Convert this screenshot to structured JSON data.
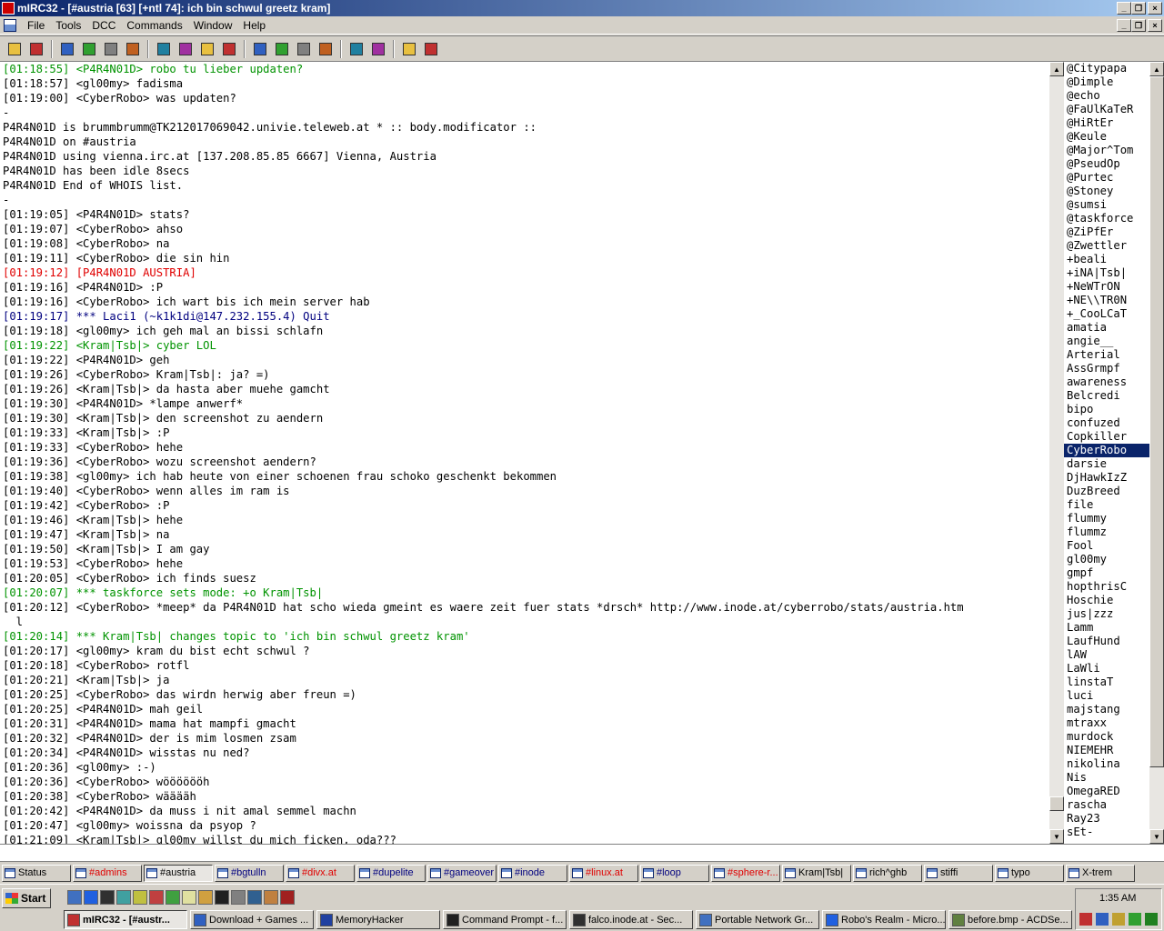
{
  "window": {
    "title": "mIRC32 - [#austria [63] [+ntl 74]: ich bin schwul greetz kram]"
  },
  "menu": {
    "items": [
      "File",
      "Tools",
      "DCC",
      "Commands",
      "Window",
      "Help"
    ]
  },
  "toolbar": {
    "icons": [
      "connect-icon",
      "options-icon",
      "address-book-icon",
      "remote-icon",
      "list-channels-icon",
      "chat-icon",
      "received-files-icon",
      "finger-icon",
      "timer-icon",
      "colors-icon",
      "log-icon",
      "notify-icon",
      "urls-icon",
      "cascade-icon",
      "tile-icon",
      "tile-vertical-icon",
      "help-icon",
      "about-icon"
    ]
  },
  "colors": {
    "green": "#009300",
    "red": "#e00000",
    "blue": "#00007f",
    "black": "#000000"
  },
  "chat": {
    "lines": [
      {
        "text": "[01:18:55] <P4R4N01D> robo tu lieber updaten?",
        "color": "#009300"
      },
      {
        "text": "[01:18:57] <gl00my> fadisma",
        "color": "#000000"
      },
      {
        "text": "[01:19:00] <CyberRobo> was updaten?",
        "color": "#000000"
      },
      {
        "text": "-",
        "color": "#000000"
      },
      {
        "text": "P4R4N01D is brummbrumm@TK212017069042.univie.teleweb.at * :: body.modificator ::",
        "color": "#000000"
      },
      {
        "text": "P4R4N01D on #austria",
        "color": "#000000"
      },
      {
        "text": "P4R4N01D using vienna.irc.at [137.208.85.85 6667] Vienna, Austria",
        "color": "#000000"
      },
      {
        "text": "P4R4N01D has been idle 8secs",
        "color": "#000000"
      },
      {
        "text": "P4R4N01D End of WHOIS list.",
        "color": "#000000"
      },
      {
        "text": "-",
        "color": "#000000"
      },
      {
        "text": "[01:19:05] <P4R4N01D> stats?",
        "color": "#000000"
      },
      {
        "text": "[01:19:07] <CyberRobo> ahso",
        "color": "#000000"
      },
      {
        "text": "[01:19:08] <CyberRobo> na",
        "color": "#000000"
      },
      {
        "text": "[01:19:11] <CyberRobo> die sin hin",
        "color": "#000000"
      },
      {
        "text": "[01:19:12] [P4R4N01D AUSTRIA]",
        "color": "#e00000"
      },
      {
        "text": "[01:19:16] <P4R4N01D> :P",
        "color": "#000000"
      },
      {
        "text": "[01:19:16] <CyberRobo> ich wart bis ich mein server hab",
        "color": "#000000"
      },
      {
        "text": "[01:19:17] *** Laci1 (~k1k1di@147.232.155.4) Quit",
        "color": "#00007f"
      },
      {
        "text": "[01:19:18] <gl00my> ich geh mal an bissi schlafn",
        "color": "#000000"
      },
      {
        "text": "[01:19:22] <Kram|Tsb|> cyber LOL",
        "color": "#009300"
      },
      {
        "text": "[01:19:22] <P4R4N01D> geh",
        "color": "#000000"
      },
      {
        "text": "[01:19:26] <CyberRobo> Kram|Tsb|: ja? =)",
        "color": "#000000"
      },
      {
        "text": "[01:19:26] <Kram|Tsb|> da hasta aber muehe gamcht",
        "color": "#000000"
      },
      {
        "text": "[01:19:30] <P4R4N01D> *lampe anwerf*",
        "color": "#000000"
      },
      {
        "text": "[01:19:30] <Kram|Tsb|> den screenshot zu aendern",
        "color": "#000000"
      },
      {
        "text": "[01:19:33] <Kram|Tsb|> :P",
        "color": "#000000"
      },
      {
        "text": "[01:19:33] <CyberRobo> hehe",
        "color": "#000000"
      },
      {
        "text": "[01:19:36] <CyberRobo> wozu screenshot aendern?",
        "color": "#000000"
      },
      {
        "text": "[01:19:38] <gl00my> ich hab heute von einer schoenen frau schoko geschenkt bekommen",
        "color": "#000000"
      },
      {
        "text": "[01:19:40] <CyberRobo> wenn alles im ram is",
        "color": "#000000"
      },
      {
        "text": "[01:19:42] <CyberRobo> :P",
        "color": "#000000"
      },
      {
        "text": "[01:19:46] <Kram|Tsb|> hehe",
        "color": "#000000"
      },
      {
        "text": "[01:19:47] <Kram|Tsb|> na",
        "color": "#000000"
      },
      {
        "text": "[01:19:50] <Kram|Tsb|> I am gay",
        "color": "#000000"
      },
      {
        "text": "[01:19:53] <CyberRobo> hehe",
        "color": "#000000"
      },
      {
        "text": "[01:20:05] <CyberRobo> ich finds suesz",
        "color": "#000000"
      },
      {
        "text": "[01:20:07] *** taskforce sets mode: +o Kram|Tsb|",
        "color": "#009300"
      },
      {
        "text": "[01:20:12] <CyberRobo> *meep* da P4R4N01D hat scho wieda gmeint es waere zeit fuer stats *drsch* http://www.inode.at/cyberrobo/stats/austria.htm",
        "color": "#000000"
      },
      {
        "text": "  l",
        "color": "#000000"
      },
      {
        "text": "[01:20:14] *** Kram|Tsb| changes topic to 'ich bin schwul greetz kram'",
        "color": "#009300"
      },
      {
        "text": "[01:20:17] <gl00my> kram du bist echt schwul ?",
        "color": "#000000"
      },
      {
        "text": "[01:20:18] <CyberRobo> rotfl",
        "color": "#000000"
      },
      {
        "text": "[01:20:21] <Kram|Tsb|> ja",
        "color": "#000000"
      },
      {
        "text": "[01:20:25] <CyberRobo> das wirdn herwig aber freun =)",
        "color": "#000000"
      },
      {
        "text": "[01:20:25] <P4R4N01D> mah geil",
        "color": "#000000"
      },
      {
        "text": "[01:20:31] <P4R4N01D> mama hat mampfi gmacht",
        "color": "#000000"
      },
      {
        "text": "[01:20:32] <P4R4N01D> der is mim losmen zsam",
        "color": "#000000"
      },
      {
        "text": "[01:20:34] <P4R4N01D> wisstas nu ned?",
        "color": "#000000"
      },
      {
        "text": "[01:20:36] <gl00my> :-)",
        "color": "#000000"
      },
      {
        "text": "[01:20:36] <CyberRobo> wööööööh",
        "color": "#000000"
      },
      {
        "text": "[01:20:38] <CyberRobo> wääääh",
        "color": "#000000"
      },
      {
        "text": "[01:20:42] <P4R4N01D> da muss i nit amal semmel machn",
        "color": "#000000"
      },
      {
        "text": "[01:20:47] <gl00my> woissna da psyop ?",
        "color": "#000000"
      },
      {
        "text": "[01:21:09] <Kram|Tsb|> gl00my willst du mich ficken, oda???",
        "color": "#000000"
      }
    ]
  },
  "nicklist": {
    "selected": "CyberRobo",
    "nicks": [
      "@Citypapa",
      "@Dimple",
      "@echo",
      "@FaUlKaTeR",
      "@HiRtEr",
      "@Keule",
      "@Major^Tom",
      "@PseudOp",
      "@Purtec",
      "@Stoney",
      "@sumsi",
      "@taskforce",
      "@ZiPfEr",
      "@Zwettler",
      "+beali",
      "+iNA|Tsb|",
      "+NeWTrON",
      "+NE\\\\TR0N",
      "+_CooLCaT",
      "amatia",
      "angie__",
      "Arterial",
      "AssGrmpf",
      "awareness",
      "Belcredi",
      "bipo",
      "confuzed",
      "Copkiller",
      "CyberRobo",
      "darsie",
      "DjHawkIzZ",
      "DuzBreed",
      "file",
      "flummy",
      "flummz",
      "Fool",
      "gl00my",
      "gmpf",
      "hopthrisC",
      "Hoschie",
      "jus|zzz",
      "Lamm",
      "LaufHund",
      "lAW",
      "LaWli",
      "linstaT",
      "luci",
      "majstang",
      "mtraxx",
      "murdock",
      "NIEMEHR",
      "nikolina",
      "Nis",
      "OmegaRED",
      "rascha",
      "Ray23",
      "sEt-"
    ]
  },
  "switchbar": {
    "active": "#austria",
    "windows": [
      {
        "label": "Status",
        "color": "#000000"
      },
      {
        "label": "#admins",
        "color": "#e00000"
      },
      {
        "label": "#austria",
        "color": "#000000"
      },
      {
        "label": "#bgtulln",
        "color": "#00007f"
      },
      {
        "label": "#divx.at",
        "color": "#e00000"
      },
      {
        "label": "#dupelite",
        "color": "#00007f"
      },
      {
        "label": "#gameover",
        "color": "#00007f"
      },
      {
        "label": "#inode",
        "color": "#00007f"
      },
      {
        "label": "#linux.at",
        "color": "#e00000"
      },
      {
        "label": "#loop",
        "color": "#00007f"
      },
      {
        "label": "#sphere-r...",
        "color": "#e00000"
      },
      {
        "label": "Kram|Tsb|",
        "color": "#000000"
      },
      {
        "label": "rich^ghb",
        "color": "#000000"
      },
      {
        "label": "stiffi",
        "color": "#000000"
      },
      {
        "label": "typo",
        "color": "#000000"
      },
      {
        "label": "X-trem",
        "color": "#000000"
      }
    ]
  },
  "taskbar": {
    "start_label": "Start",
    "clock": "1:35 AM",
    "quicklaunch": [
      "desktop-icon",
      "ie-icon",
      "cmd-icon",
      "app-icon",
      "search-icon",
      "paint-icon",
      "flower-icon",
      "notepad-icon",
      "pencil-icon",
      "terminal-icon",
      "gear-icon",
      "monitor-icon",
      "memory-icon",
      "ac-icon"
    ],
    "tasks": [
      {
        "label": "mIRC32 - [#austr...",
        "active": true
      },
      {
        "label": "Download + Games ...",
        "active": false
      },
      {
        "label": "MemoryHacker",
        "active": false
      },
      {
        "label": "Command Prompt - f...",
        "active": false
      },
      {
        "label": "falco.inode.at - Sec...",
        "active": false
      },
      {
        "label": "Portable Network Gr...",
        "active": false
      },
      {
        "label": "Robo's Realm - Micro...",
        "active": false
      },
      {
        "label": "before.bmp - ACDSe...",
        "active": false
      }
    ]
  }
}
